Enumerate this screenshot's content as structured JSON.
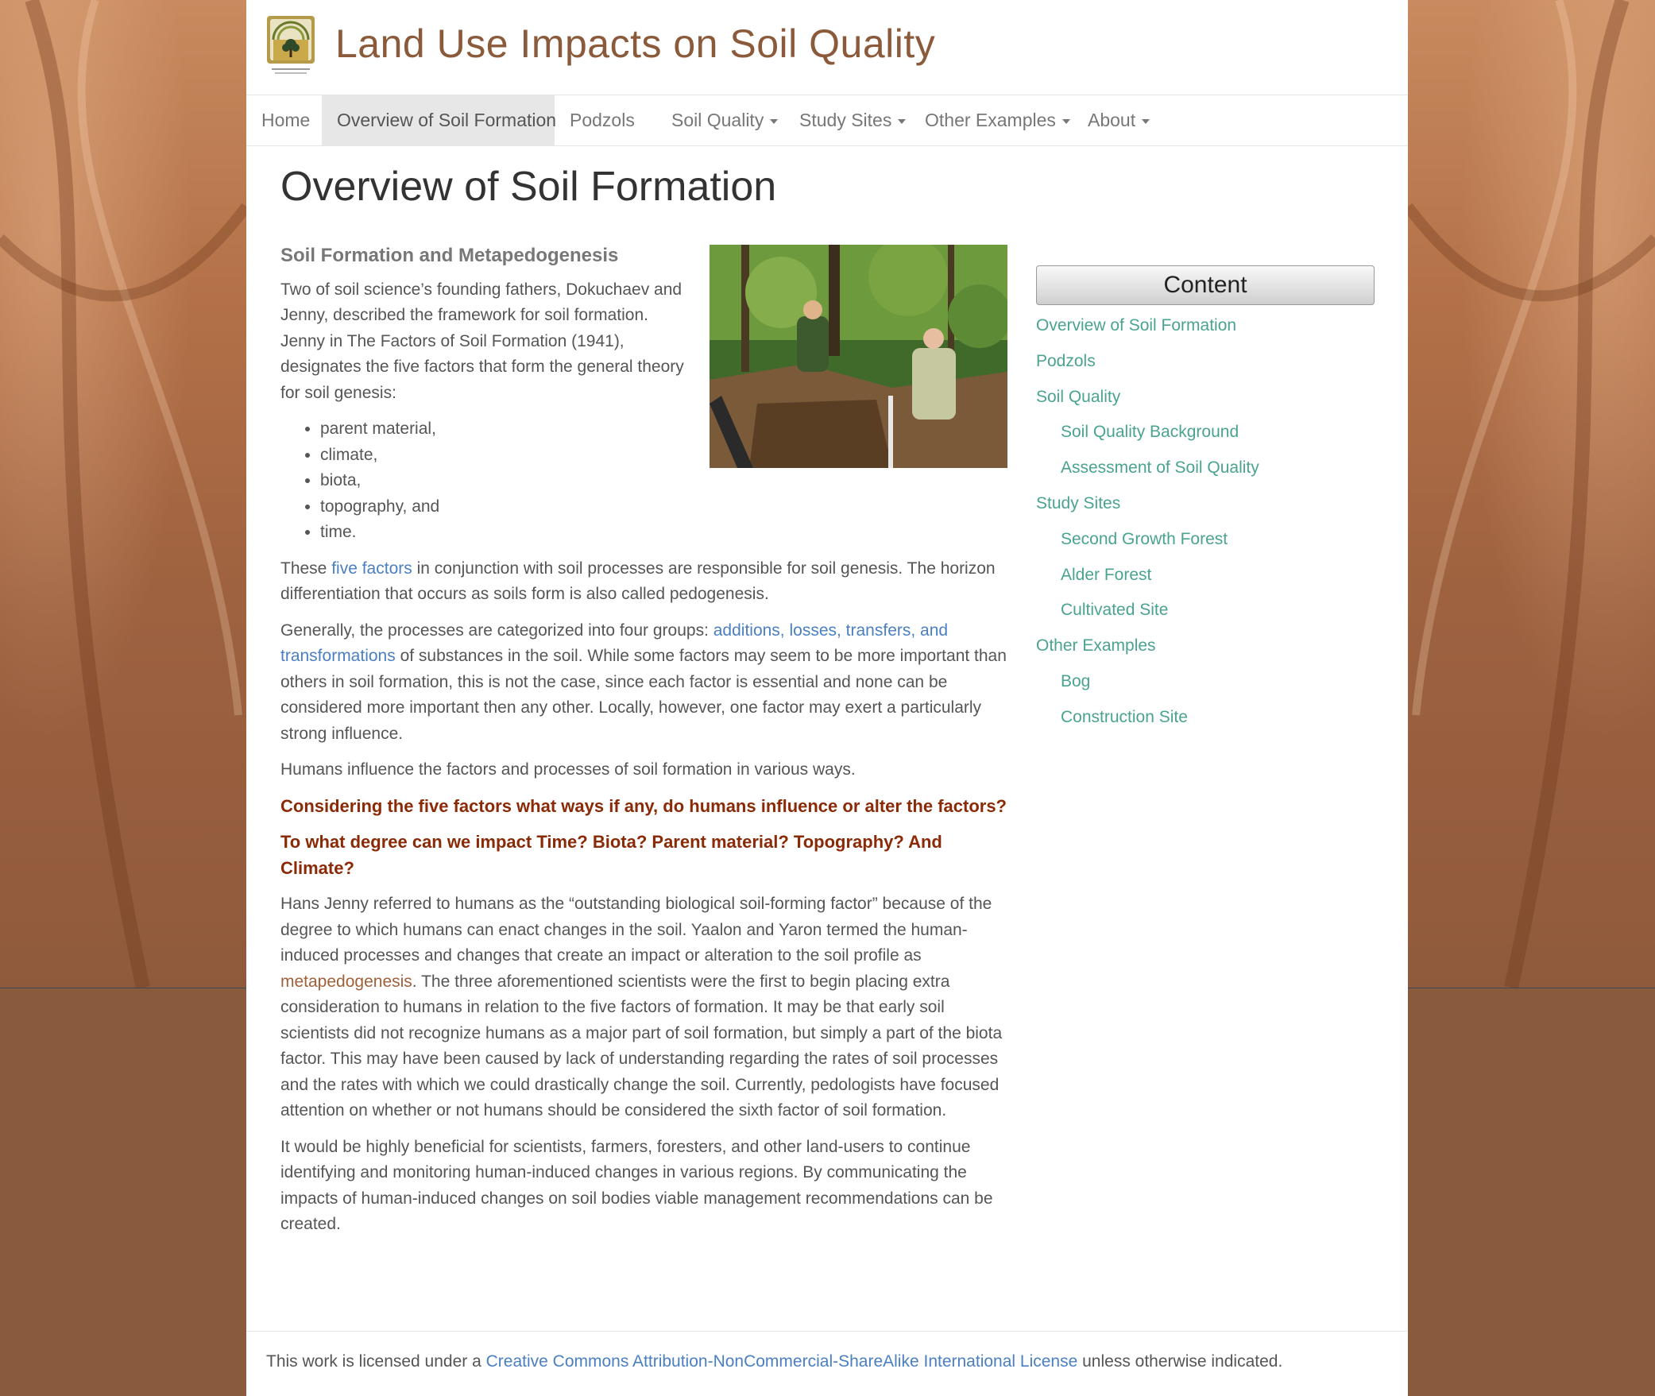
{
  "site": {
    "title": "Land Use Impacts on Soil Quality",
    "logo_icon": "tree-logo-icon"
  },
  "nav": {
    "items": [
      {
        "label": "Home",
        "dropdown": false,
        "active": false
      },
      {
        "label": "Overview of Soil Formation",
        "dropdown": false,
        "active": true
      },
      {
        "label": "Podzols",
        "dropdown": false,
        "active": false
      },
      {
        "label": "Soil Quality",
        "dropdown": true,
        "active": false
      },
      {
        "label": "Study Sites",
        "dropdown": true,
        "active": false
      },
      {
        "label": "Other Examples",
        "dropdown": true,
        "active": false
      },
      {
        "label": "About",
        "dropdown": true,
        "active": false
      }
    ]
  },
  "page": {
    "title": "Overview of Soil Formation",
    "section_heading": "Soil Formation and Metapedogenesis",
    "intro": "Two of soil science’s founding fathers, Dokuchaev and Jenny, described the framework for soil formation. Jenny in The Factors of Soil Formation (1941), designates the five factors that form the general theory for soil genesis:",
    "factors": [
      "parent material,",
      "climate,",
      "biota,",
      "topography, and",
      "time."
    ],
    "p2_before": "These ",
    "p2_link": "five factors",
    "p2_after": " in conjunction with soil processes are responsible for soil genesis.  The horizon differentiation that occurs as soils form is also called pedogenesis.",
    "p3_before": "Generally, the processes are categorized into four groups: ",
    "p3_link": "additions, losses, transfers, and transformations",
    "p3_after": " of substances in the soil. While some factors may seem to be more important than others in soil formation, this is not the case, since each factor is essential and none can be considered more important then any other.  Locally, however, one factor may exert a particularly strong influence.",
    "p4": "Humans influence the factors and processes of soil formation in various ways.",
    "q1": "Considering the five factors what ways if any, do humans influence or alter the factors?",
    "q2": "To what degree can we impact Time? Biota? Parent material? Topography? And Climate?",
    "p5_before": "Hans Jenny referred to humans as the “outstanding biological soil-forming factor” because of the degree to which humans can enact changes in the soil. Yaalon and Yaron termed the human-induced processes and changes that create an impact or alteration to the soil profile as ",
    "p5_link": "metapedogenesis",
    "p5_after": ". The three aforementioned scientists were the first to begin placing extra consideration to humans in relation to the five factors of formation.  It may be that early soil scientists did not recognize humans as a major part of soil formation, but simply a part of the biota factor.  This may have been caused by lack of understanding regarding the rates of soil processes and the rates with which we could drastically change the soil. Currently, pedologists have focused attention on whether or not humans should be considered the sixth factor of soil formation.",
    "p6": "It would be highly beneficial for scientists, farmers, foresters, and other land-users to continue identifying and monitoring human-induced changes in various regions.  By communicating the impacts of human-induced changes on soil bodies viable management recommendations can be created."
  },
  "sidebar": {
    "button_label": "Content",
    "items": [
      {
        "label": "Overview of Soil Formation",
        "level": 1
      },
      {
        "label": "Podzols",
        "level": 1
      },
      {
        "label": "Soil Quality",
        "level": 1
      },
      {
        "label": "Soil Quality Background",
        "level": 2
      },
      {
        "label": "Assessment of Soil Quality",
        "level": 2
      },
      {
        "label": "Study Sites",
        "level": 1
      },
      {
        "label": "Second Growth Forest",
        "level": 2
      },
      {
        "label": "Alder Forest",
        "level": 2
      },
      {
        "label": "Cultivated Site",
        "level": 2
      },
      {
        "label": "Other Examples",
        "level": 1
      },
      {
        "label": "Bog",
        "level": 2
      },
      {
        "label": "Construction Site",
        "level": 2
      }
    ]
  },
  "footer": {
    "before": "This work is licensed under a ",
    "link": "Creative Commons Attribution-NonCommercial-ShareAlike International License",
    "after": " unless otherwise indicated."
  },
  "colors": {
    "title_brown": "#8b5a3a",
    "sidebar_link": "#4aa390",
    "body_link": "#4a7fc1",
    "question": "#8a2a06",
    "background": "#8a5a3c"
  }
}
